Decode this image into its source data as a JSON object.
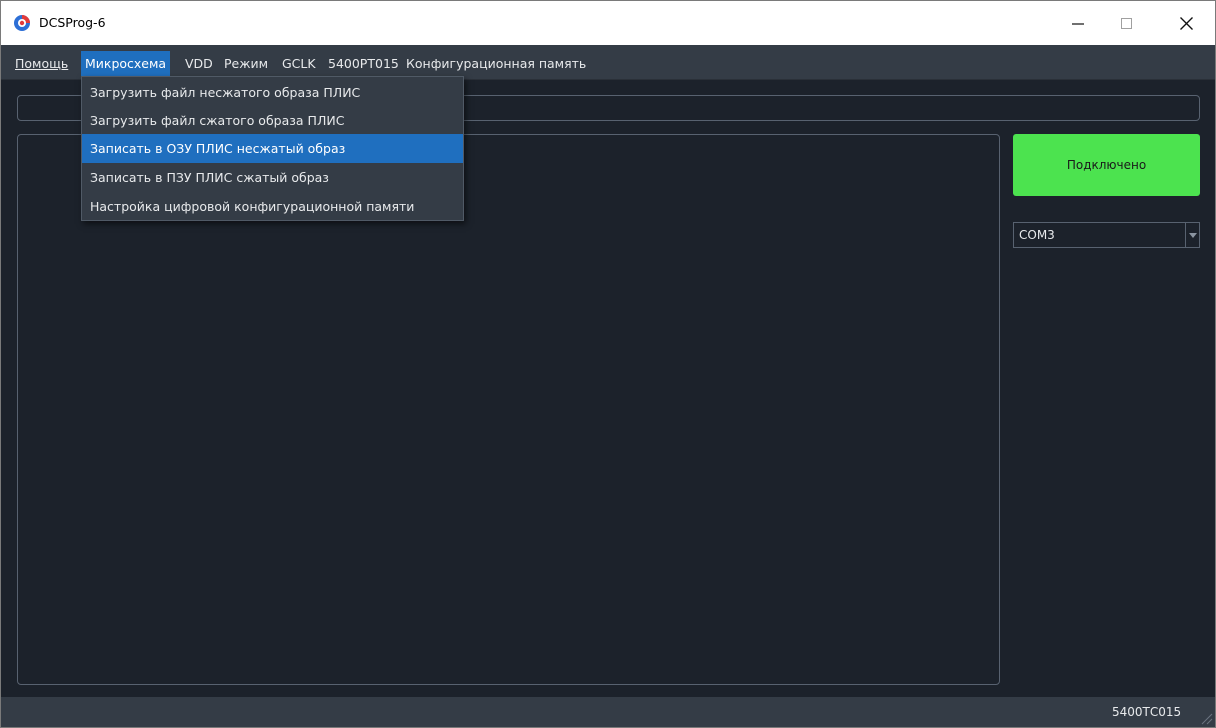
{
  "window": {
    "title": "DCSProg-6"
  },
  "menubar": {
    "items": [
      {
        "label": "Помощь",
        "active": false
      },
      {
        "label": "Микросхема",
        "active": true
      },
      {
        "label": "VDD",
        "active": false
      },
      {
        "label": "Режим",
        "active": false
      },
      {
        "label": "GCLK",
        "active": false
      },
      {
        "label": "5400РТ015",
        "active": false
      },
      {
        "label": "Конфигурационная память",
        "active": false
      }
    ]
  },
  "dropdown": {
    "items": [
      {
        "label": "Загрузить файл несжатого образа ПЛИС",
        "highlighted": false
      },
      {
        "label": "Загрузить файл сжатого образа ПЛИС",
        "highlighted": false
      },
      {
        "label": "Записать в ОЗУ ПЛИС несжатый образ",
        "highlighted": true
      },
      {
        "label": "Записать в ПЗУ ПЛИС сжатый образ",
        "highlighted": false
      },
      {
        "label": "Настройка цифровой конфигурационной памяти",
        "highlighted": false
      }
    ]
  },
  "connection": {
    "status_label": "Подключено",
    "status_color": "#4ce34f"
  },
  "port": {
    "selected": "COM3"
  },
  "statusbar": {
    "chip": "5400ТС015"
  },
  "colors": {
    "background": "#1c222b",
    "menubar": "#343c46",
    "accent": "#1f6fbf"
  },
  "icons": {
    "app": "app-logo-icon",
    "minimize": "minimize-icon",
    "maximize": "maximize-icon",
    "close": "close-icon",
    "dropdown_arrow": "chevron-down-icon",
    "grip": "resize-grip-icon"
  }
}
